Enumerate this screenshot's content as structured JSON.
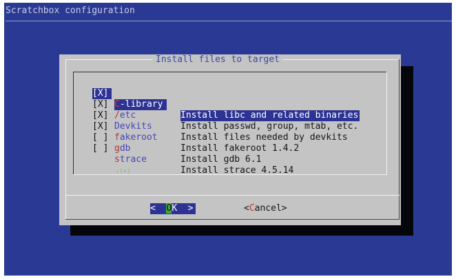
{
  "app": {
    "title": "Scratchbox configuration"
  },
  "dialog": {
    "title": "Install files to target",
    "items": [
      {
        "check": "[X]",
        "hot": "C",
        "rest": "-library",
        "desc": "Install libc and related binaries",
        "selected": true
      },
      {
        "check": "[X]",
        "hot": "/",
        "rest": "etc",
        "desc": "Install passwd, group, mtab, etc."
      },
      {
        "check": "[X]",
        "hot": "",
        "rest": "Devkits",
        "desc": "Install files needed by devkits"
      },
      {
        "check": "[X]",
        "hot": "f",
        "rest": "akeroot",
        "desc": "Install fakeroot 1.4.2"
      },
      {
        "check": "[ ]",
        "hot": "g",
        "rest": "db",
        "desc": "Install gdb 6.1"
      },
      {
        "check": "[ ]",
        "hot": "s",
        "rest": "trace",
        "desc": "Install strace 4.5.14"
      }
    ],
    "more_indicator": "↓(+)",
    "ok_button": {
      "left": "<  ",
      "hot": "O",
      "rest": "K  >"
    },
    "cancel_button": {
      "left": "<",
      "hot": "C",
      "rest": "ancel>"
    }
  },
  "colors": {
    "screen_bg": "#2a3a94",
    "dialog_bg": "#c4c4c4",
    "selection_bg": "#2d3393",
    "hotkey_red": "#b8342a",
    "tag_blue": "#4347b8",
    "ok_hotkey_green": "#3faa3a"
  }
}
